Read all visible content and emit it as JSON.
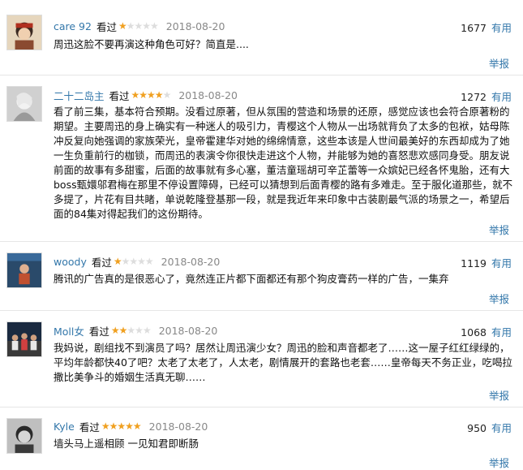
{
  "useful_label": "有用",
  "report_label": "举报",
  "seen_label": "看过",
  "reviews": [
    {
      "user": "care 92",
      "rating": 1,
      "date": "2018-08-20",
      "votes": "1677",
      "comment": "周迅这脸不要再演这种角色可好？简直是...."
    },
    {
      "user": "二十二岛主",
      "rating": 4,
      "date": "2018-08-20",
      "votes": "1272",
      "comment": "看了前三集，基本符合预期。没看过原著，但从氛围的营造和场景的还原，感觉应该也会符合原著粉的期望。主要周迅的身上确实有一种迷人的吸引力，青樱这个人物从一出场就背负了太多的包袱，姑母陈冲反复向她强调的家族荣光，皇帝霍建华对她的绵绵情意，这些本该是人世间最美好的东西却成为了她一生负重前行的枷锁，而周迅的表演令你很快走进这个人物，并能够为她的喜怒悲欢感同身受。朋友说前面的故事有多甜蜜，后面的故事就有多心塞，董洁童瑶胡可辛芷蕾等一众嫔妃已经各怀鬼胎，还有大boss甄嬛邬君梅在那里不停设置障碍，已经可以猜想到后面青樱的路有多难走。至于服化道那些，就不多提了，片花有目共睹，单说乾隆登基那一段，就是我近年来印象中古装剧最气派的场景之一，希望后面的84集对得起我们的这份期待。"
    },
    {
      "user": "woody",
      "rating": 1,
      "date": "2018-08-20",
      "votes": "1119",
      "comment": "腾讯的广告真的是很恶心了，竟然连正片都下面都还有那个狗皮膏药一样的广告，一集弃"
    },
    {
      "user": "Moll女",
      "rating": 2,
      "date": "2018-08-20",
      "votes": "1068",
      "comment": "我妈说，剧组找不到演员了吗？居然让周迅演少女？周迅的脸和声音都老了……这一屋子红红绿绿的，平均年龄都快40了吧？太老了太老了，人太老，剧情展开的套路也老套……皇帝每天不务正业，吃喝拉撒比美争斗的婚姻生活真无聊……"
    },
    {
      "user": "Kyle",
      "rating": 5,
      "date": "2018-08-20",
      "votes": "950",
      "comment": "墙头马上遥相顾 一见知君即断肠"
    }
  ]
}
